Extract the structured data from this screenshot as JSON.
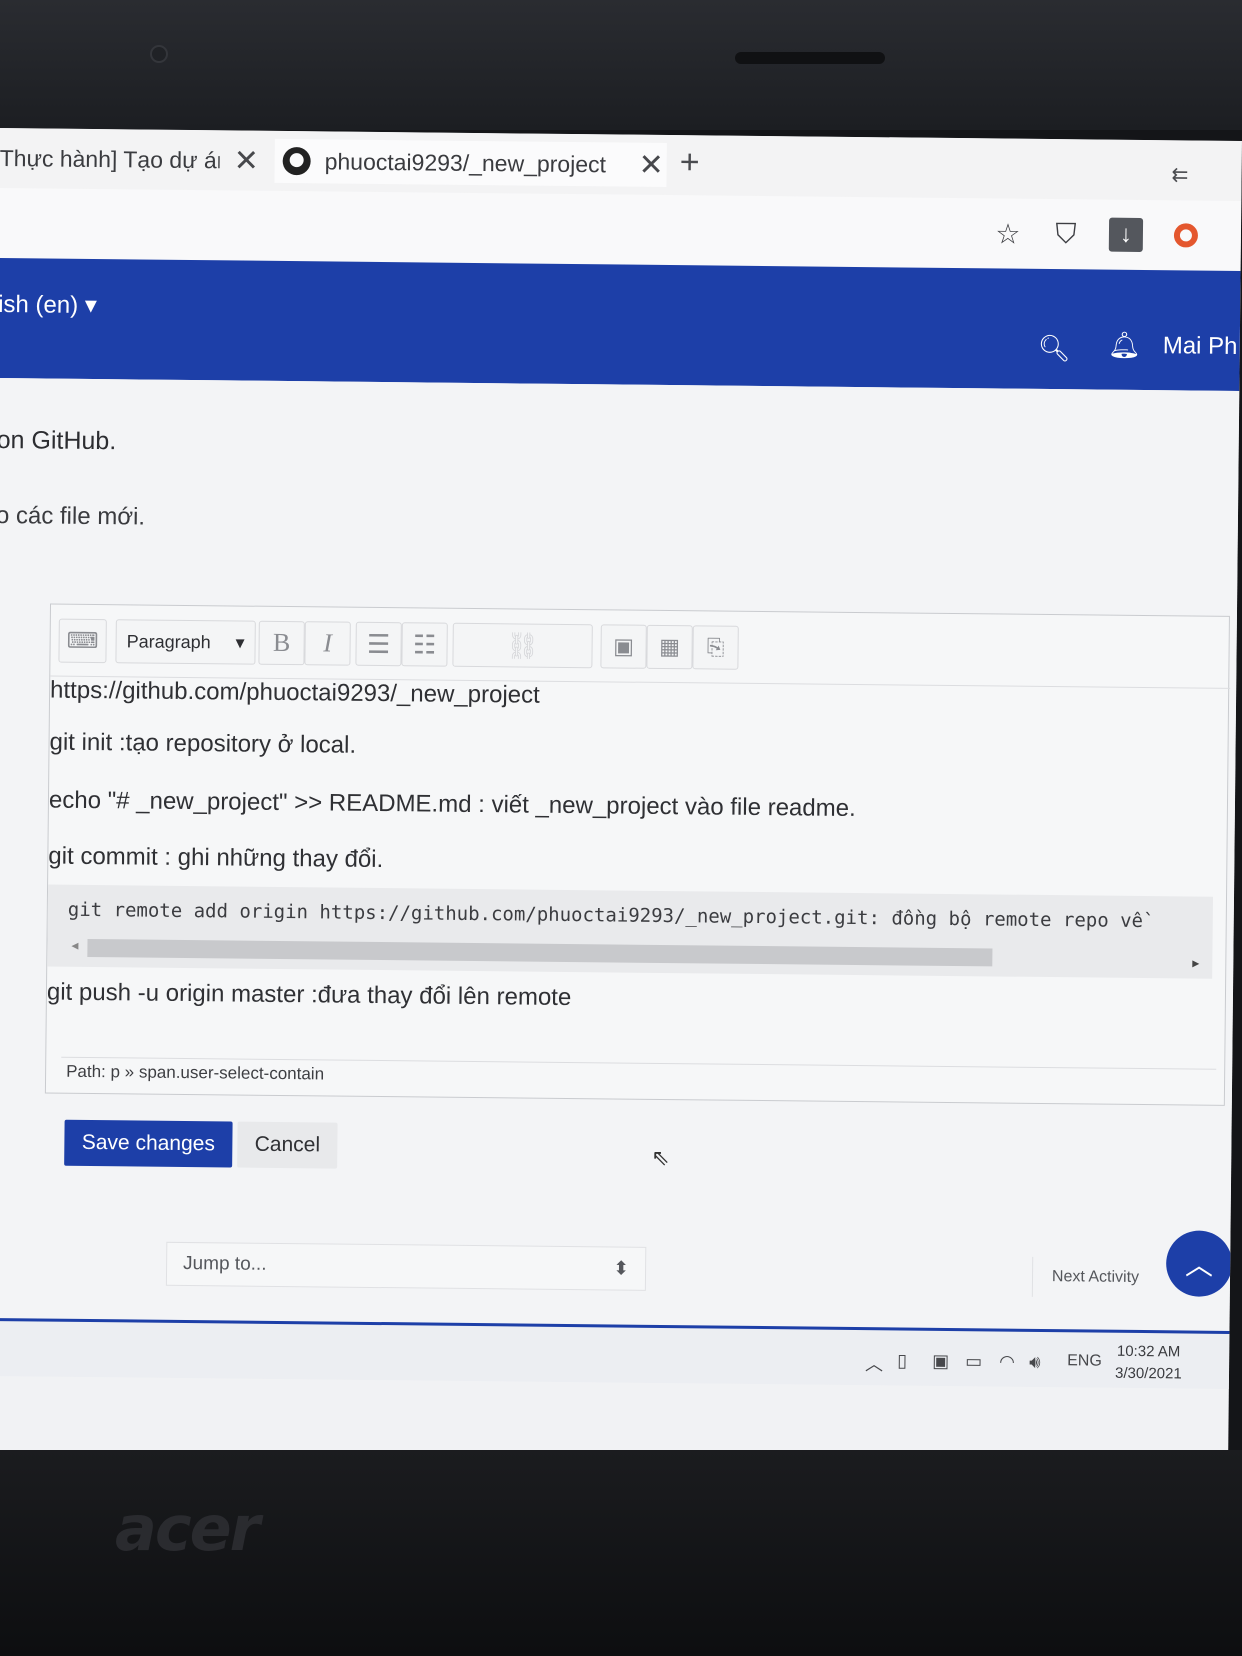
{
  "browser": {
    "tabs": [
      {
        "title": "Thực hành] Tạo dự án"
      },
      {
        "title": "phuoctai9293/_new_project"
      }
    ],
    "new_tab": "+",
    "close_glyph": "✕"
  },
  "navbar": {
    "language": "ish (en) ▾",
    "user": "Mai Ph"
  },
  "page": {
    "hint_line_1": "on GitHub.",
    "hint_line_2": "o các file mới."
  },
  "editor": {
    "block_format": "Paragraph",
    "lines": [
      "https://github.com/phuoctai9293/_new_project",
      "git init :tạo  repository ở local.",
      "echo \"# _new_project\" >> README.md : viết  _new_project vào file readme.",
      "git commit : ghi những thay đổi.",
      "git remote add origin https://github.com/phuoctai9293/_new_project.git: đồng bộ remote repo về",
      "git push -u origin master :đưa thay đổi lên remote"
    ],
    "path": "Path: p » span.user-select-contain"
  },
  "actions": {
    "save_label": "Save changes",
    "cancel_label": "Cancel"
  },
  "footer_nav": {
    "jump_placeholder": "Jump to...",
    "next_label": "Next Activity"
  },
  "taskbar": {
    "language": "ENG",
    "time": "10:32 AM",
    "date": "3/30/2021"
  },
  "device": {
    "brand": "acer"
  },
  "colors": {
    "brand_blue": "#1d3fa8"
  }
}
